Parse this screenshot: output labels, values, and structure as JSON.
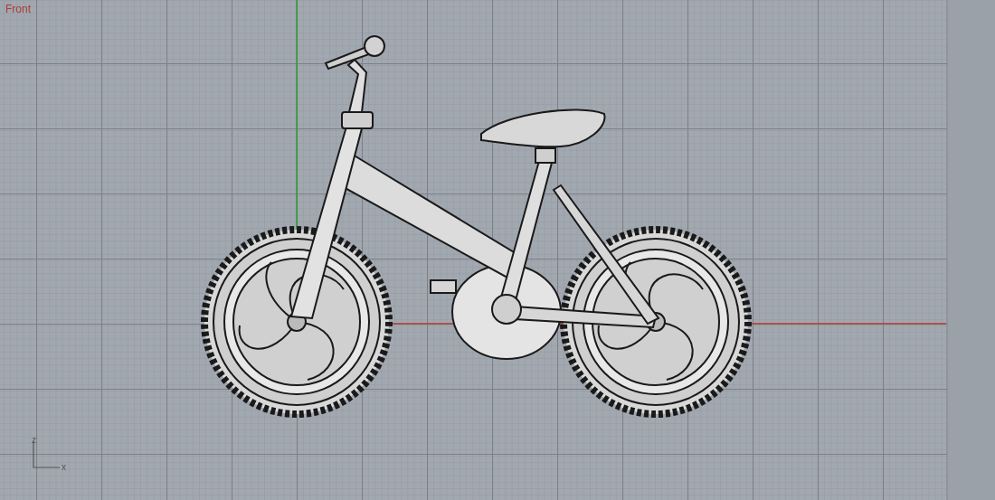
{
  "viewport": {
    "title": "Front",
    "vertical_axis_label": "z",
    "horizontal_axis_label": "x"
  }
}
